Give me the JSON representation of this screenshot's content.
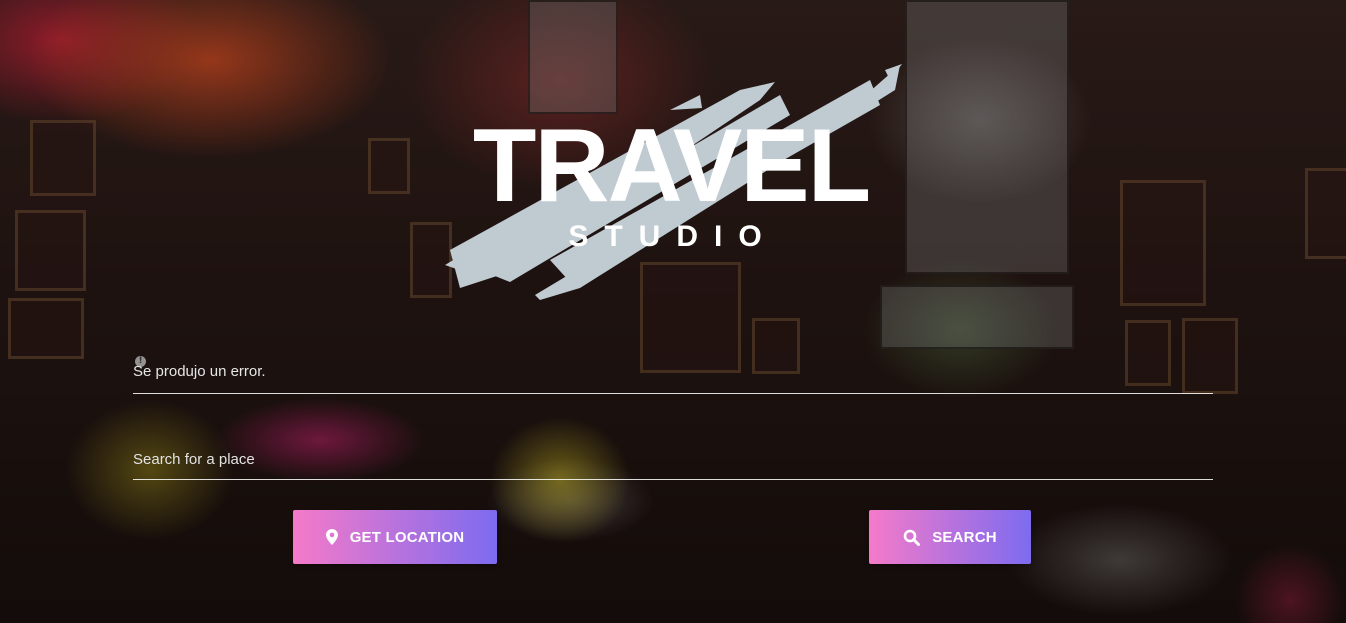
{
  "logo": {
    "title": "TRAVEL",
    "subtitle": "STUDIO",
    "brush_color": "#c8d4dc"
  },
  "form": {
    "error_message": "Se produjo un error.",
    "search_placeholder": "Search for a place",
    "search_value": ""
  },
  "buttons": {
    "get_location": {
      "label": "GET LOCATION",
      "icon": "map-marker-icon"
    },
    "search": {
      "label": "SEARCH",
      "icon": "search-icon"
    }
  },
  "colors": {
    "button_gradient_start": "#f57ac9",
    "button_gradient_end": "#7d6bf0",
    "text": "#ffffff"
  }
}
